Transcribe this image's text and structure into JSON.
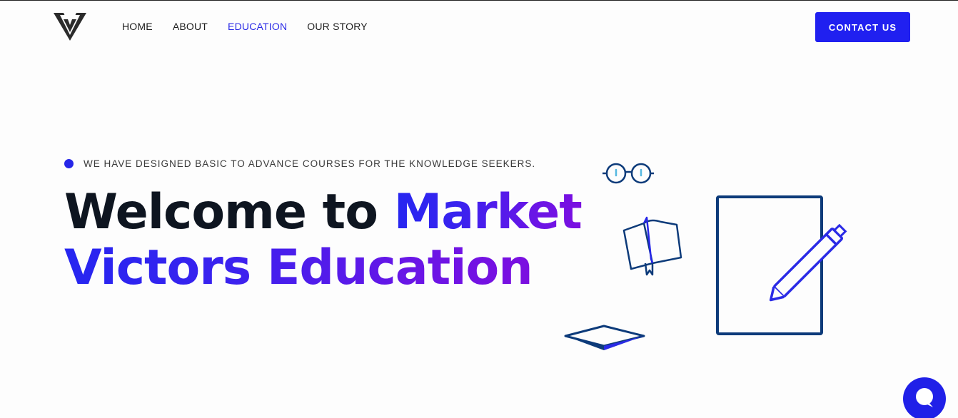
{
  "header": {
    "logo_text": "V",
    "nav": [
      {
        "label": "HOME",
        "active": false
      },
      {
        "label": "ABOUT",
        "active": false
      },
      {
        "label": "EDUCATION",
        "active": true
      },
      {
        "label": "OUR STORY",
        "active": false
      }
    ],
    "contact_label": "CONTACT US"
  },
  "hero": {
    "tagline": "WE HAVE DESIGNED BASIC TO ADVANCE COURSES FOR THE KNOWLEDGE SEEKERS.",
    "headline_part1": "Welcome to ",
    "headline_part2": "Market",
    "headline_part3": "Victors Education"
  },
  "colors": {
    "accent": "#2020f0",
    "dark_text": "#0e1520",
    "illustration_navy": "#0d3b7a"
  },
  "icons": [
    "logo-icon",
    "glasses-icon",
    "open-book-icon",
    "notepad-pen-icon",
    "graduation-cap-icon",
    "chat-icon"
  ]
}
